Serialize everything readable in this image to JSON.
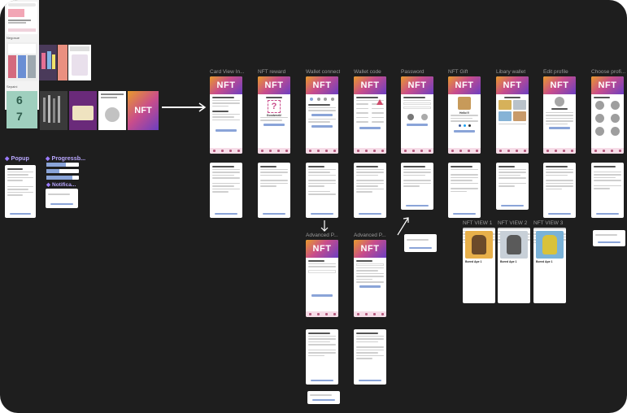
{
  "frames": [
    {
      "title": "Card View In...",
      "kind": "card-view"
    },
    {
      "title": "NFT reward",
      "kind": "reward"
    },
    {
      "title": "Wallet connect",
      "kind": "wallet"
    },
    {
      "title": "Wallet code",
      "kind": "code"
    },
    {
      "title": "Password",
      "kind": "password"
    },
    {
      "title": "NFT Gift",
      "kind": "gift"
    },
    {
      "title": "Libary wallet",
      "kind": "library"
    },
    {
      "title": "Edit profile",
      "kind": "edit"
    },
    {
      "title": "Choose profi...",
      "kind": "choose"
    }
  ],
  "advanced_frames": [
    {
      "title": "Advanced P..."
    },
    {
      "title": "Advanced P..."
    }
  ],
  "nft_views": [
    {
      "title": "NFT VIEW 1",
      "name": "Bored Ape 1",
      "color": "#e8b04a"
    },
    {
      "title": "NFT VIEW 2",
      "name": "Bored Ape 1",
      "color": "#c8d0d8"
    },
    {
      "title": "NFT VIEW 3",
      "name": "Bored Ape 1",
      "color": "#79b2d8"
    }
  ],
  "components": {
    "popup_title": "Popup",
    "progress_title": "Progressb...",
    "notification_title": "Notifica..."
  },
  "colors": {
    "canvas": "#1e1e1e",
    "accent": "#9b7bff",
    "button": "#8aa4d8",
    "nft_gradient_start": "#e89a2c",
    "nft_gradient_end": "#6b3fc1"
  },
  "ui_text": {
    "nft_label": "NFT",
    "hello_text": "Hello!!!",
    "goodwork_text": "Goodwork!"
  },
  "left_panel": {
    "banner_numbers": [
      "6",
      "7"
    ],
    "section_labels": [
      "Negosue",
      "Sepaini"
    ]
  }
}
